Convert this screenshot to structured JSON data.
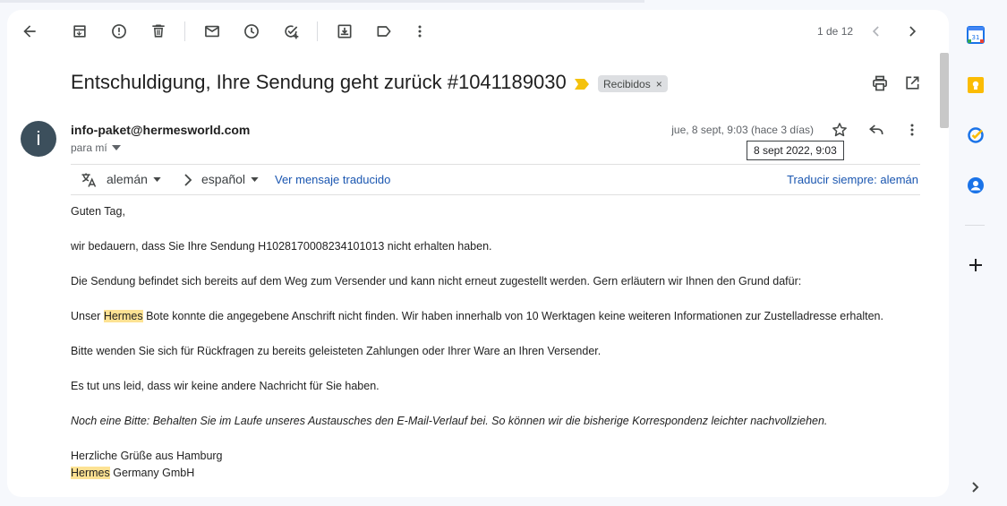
{
  "toolbar": {
    "back": "arrow-back-icon",
    "archive": "archive-icon",
    "spam": "report-spam-icon",
    "delete": "delete-icon",
    "mark_unread": "mail-icon",
    "snooze": "clock-icon",
    "add_task": "add-task-icon",
    "move": "move-to-icon",
    "labels": "label-icon",
    "more": "more-vert-icon",
    "pager_text": "1 de 12",
    "prev": "chevron-left-icon",
    "next": "chevron-right-icon"
  },
  "email": {
    "subject": "Entschuldigung, Ihre Sendung geht zurück #1041189030",
    "label_chip": "Recibidos",
    "label_remove": "×",
    "avatar_letter": "i",
    "sender": "info-paket@hermesworld.com",
    "to": "para mí",
    "date": "jue, 8 sept, 9:03 (hace 3 días)",
    "tooltip": "8 sept 2022, 9:03"
  },
  "translation": {
    "source_lang": "alemán",
    "target_lang": "español",
    "view_translated": "Ver mensaje traducido",
    "always_translate": "Traducir siempre: alemán"
  },
  "body": {
    "greeting": "Guten Tag,",
    "p1": "wir bedauern, dass Sie Ihre Sendung H1028170008234101013 nicht erhalten haben.",
    "p2": "Die Sendung befindet sich bereits auf dem Weg zum Versender und kann nicht erneut zugestellt werden. Gern erläutern wir Ihnen den Grund dafür:",
    "p3_prefix": "Unser ",
    "p3_hl": "Hermes",
    "p3_suffix": " Bote konnte die angegebene Anschrift nicht finden. Wir haben innerhalb von 10 Werktagen keine weiteren Informationen zur Zustelladresse erhalten.",
    "p4": "Bitte wenden Sie sich für Rückfragen zu bereits geleisteten Zahlungen oder Ihrer Ware an Ihren Versender.",
    "p5": "Es tut uns leid, dass wir keine andere Nachricht für Sie haben.",
    "p6": "Noch eine Bitte: Behalten Sie im Laufe unseres Austausches den E-Mail-Verlauf bei. So können wir die bisherige Korrespondenz leichter nachvollziehen.",
    "closing": "Herzliche Grüße aus Hamburg",
    "sig_hl": "Hermes",
    "sig_suffix": " Germany GmbH"
  },
  "side_panel": {
    "calendar_day": "31"
  },
  "colors": {
    "highlight": "#fde293",
    "link": "#1a56b0",
    "importance": "#f4c20d",
    "avatar": "#3c4f5c"
  }
}
